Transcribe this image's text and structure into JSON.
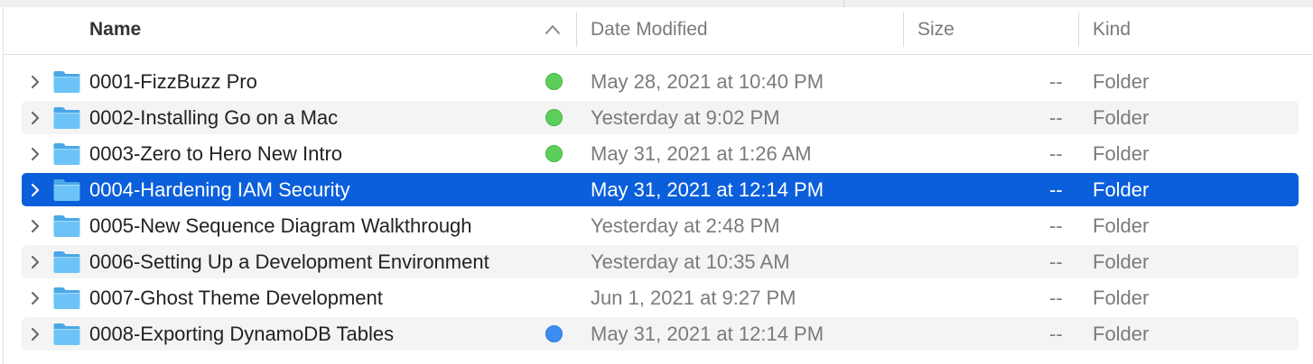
{
  "columns": {
    "name": "Name",
    "date_modified": "Date Modified",
    "size": "Size",
    "kind": "Kind",
    "sort_direction": "ascending"
  },
  "tag_colors": {
    "green": "#5ccf5a",
    "blue": "#3b8ef0"
  },
  "selection_color": "#0b5fdb",
  "rows": [
    {
      "name": "0001-FizzBuzz Pro",
      "date": "May 28, 2021 at 10:40 PM",
      "size": "--",
      "kind": "Folder",
      "tag": "green",
      "selected": false
    },
    {
      "name": "0002-Installing Go on a Mac",
      "date": "Yesterday at 9:02 PM",
      "size": "--",
      "kind": "Folder",
      "tag": "green",
      "selected": false
    },
    {
      "name": "0003-Zero to Hero New Intro",
      "date": "May 31, 2021 at 1:26 AM",
      "size": "--",
      "kind": "Folder",
      "tag": "green",
      "selected": false
    },
    {
      "name": "0004-Hardening IAM Security",
      "date": "May 31, 2021 at 12:14 PM",
      "size": "--",
      "kind": "Folder",
      "tag": null,
      "selected": true
    },
    {
      "name": "0005-New Sequence Diagram Walkthrough",
      "date": "Yesterday at 2:48 PM",
      "size": "--",
      "kind": "Folder",
      "tag": null,
      "selected": false
    },
    {
      "name": "0006-Setting Up a Development Environment",
      "date": "Yesterday at 10:35 AM",
      "size": "--",
      "kind": "Folder",
      "tag": null,
      "selected": false
    },
    {
      "name": "0007-Ghost Theme Development",
      "date": "Jun 1, 2021 at 9:27 PM",
      "size": "--",
      "kind": "Folder",
      "tag": null,
      "selected": false
    },
    {
      "name": "0008-Exporting DynamoDB Tables",
      "date": "May 31, 2021 at 12:14 PM",
      "size": "--",
      "kind": "Folder",
      "tag": "blue",
      "selected": false
    }
  ]
}
